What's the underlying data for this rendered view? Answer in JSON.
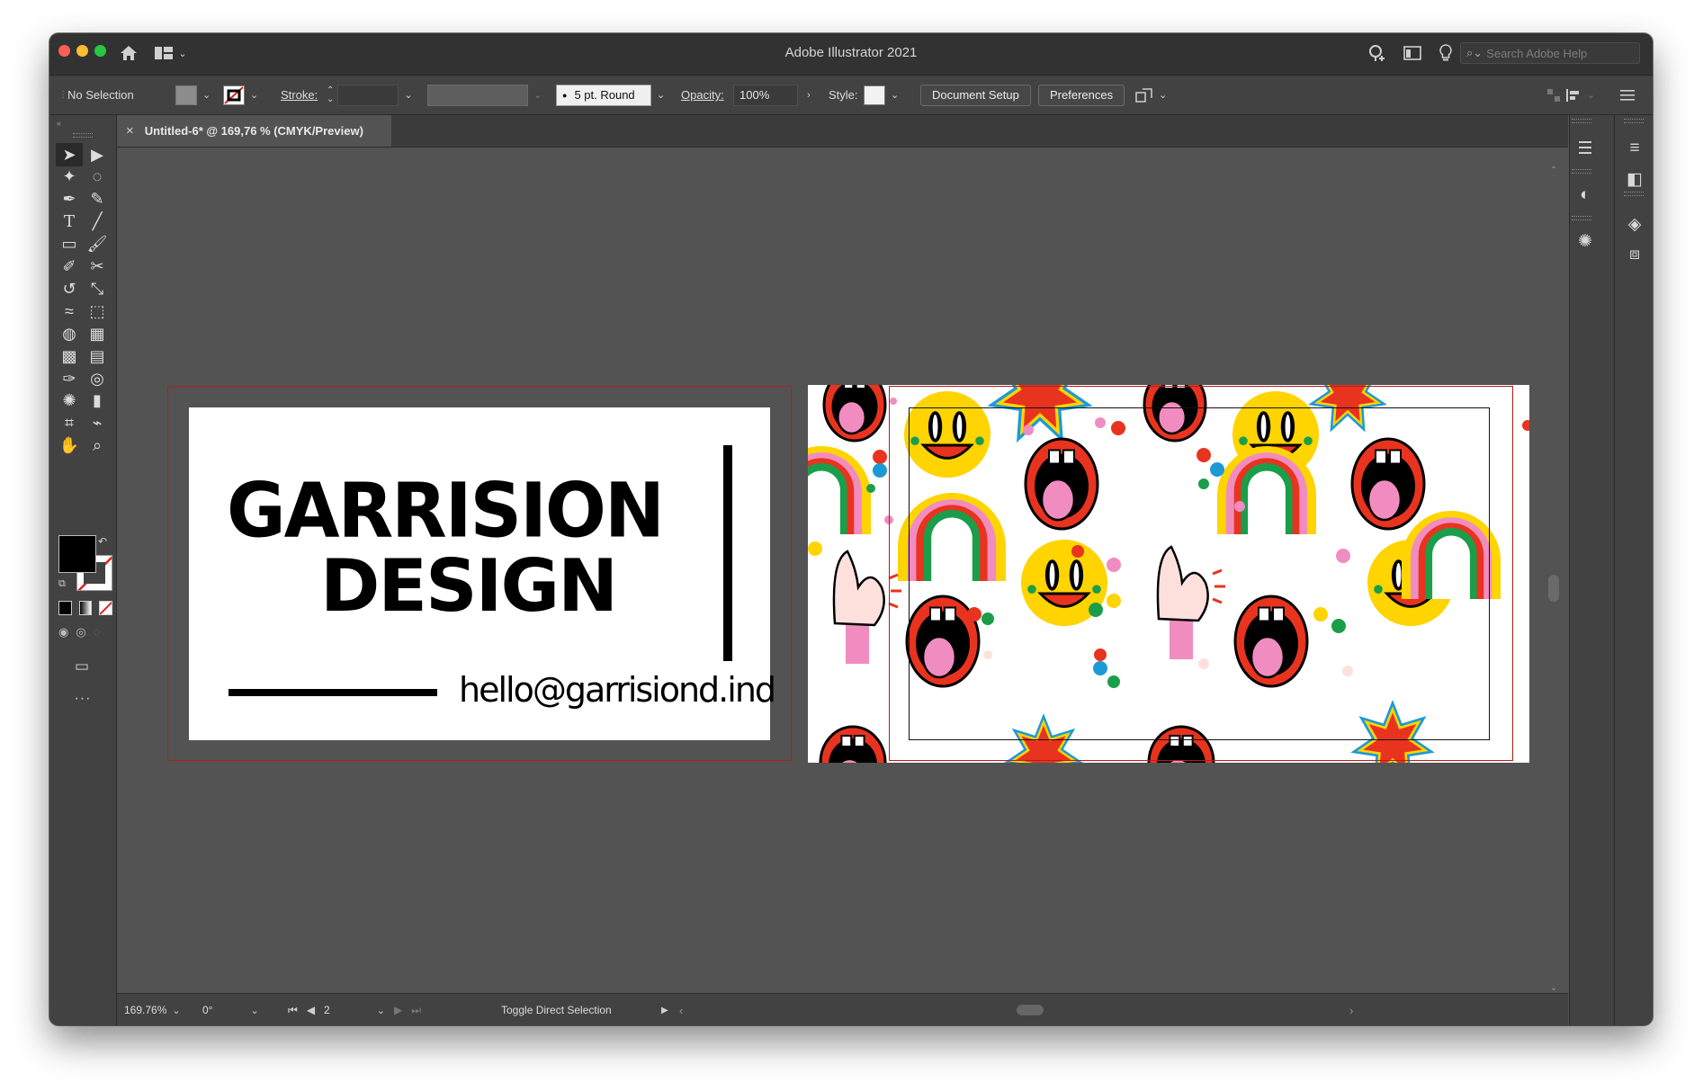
{
  "app": {
    "title": "Adobe Illustrator 2021",
    "search_placeholder": "Search Adobe Help",
    "traffic_lights": [
      "#ff5f57",
      "#febc2e",
      "#28c840"
    ]
  },
  "control_bar": {
    "selection_label": "No Selection",
    "stroke_label": "Stroke:",
    "stroke_value": "",
    "brush_label": "5 pt. Round",
    "opacity_label": "Opacity:",
    "opacity_value": "100%",
    "style_label": "Style:",
    "document_setup_button": "Document Setup",
    "preferences_button": "Preferences"
  },
  "document_tab": {
    "title": "Untitled-6* @ 169,76 % (CMYK/Preview)",
    "close_glyph": "×"
  },
  "canvas": {
    "card_front": {
      "line1": "GARRISION",
      "line2": "DESIGN",
      "email": "hello@garrisiond.ind"
    },
    "card_back": {
      "pattern_colors": [
        "#ffd400",
        "#e8331f",
        "#f18cc0",
        "#1a9e4a",
        "#1b9ad6",
        "#000000"
      ]
    }
  },
  "status_bar": {
    "zoom": "169.76%",
    "rotation": "0°",
    "artboard_number": "2",
    "tool_hint": "Toggle Direct Selection"
  },
  "toolbar": {
    "more_tools_glyph": "···",
    "icons": [
      "selection-icon",
      "direct-selection-icon",
      "magic-wand-icon",
      "lasso-icon",
      "pen-icon",
      "curvature-icon",
      "type-icon",
      "line-segment-icon",
      "rectangle-icon",
      "paintbrush-icon",
      "shaper-icon",
      "scissors-icon",
      "rotate-icon",
      "scale-icon",
      "warp-icon",
      "free-transform-icon",
      "shape-builder-icon",
      "perspective-grid-icon",
      "mesh-icon",
      "gradient-icon",
      "eyedropper-icon",
      "blend-icon",
      "symbol-sprayer-icon",
      "column-graph-icon",
      "artboard-icon",
      "slice-icon",
      "hand-icon",
      "zoom-icon"
    ]
  },
  "right_panels": {
    "icons": [
      "properties-icon",
      "appearance-icon",
      "brushes-icon",
      "character-icon",
      "paragraph-icon",
      "opentype-icon",
      "transform-icon",
      "pathfinder-icon",
      "align-icon",
      "swatches-icon",
      "color-guide-icon",
      "symbols-icon",
      "links-icon",
      "properties-settings-icon",
      "gradient-panel-icon",
      "layers-icon",
      "artboards-icon"
    ]
  }
}
